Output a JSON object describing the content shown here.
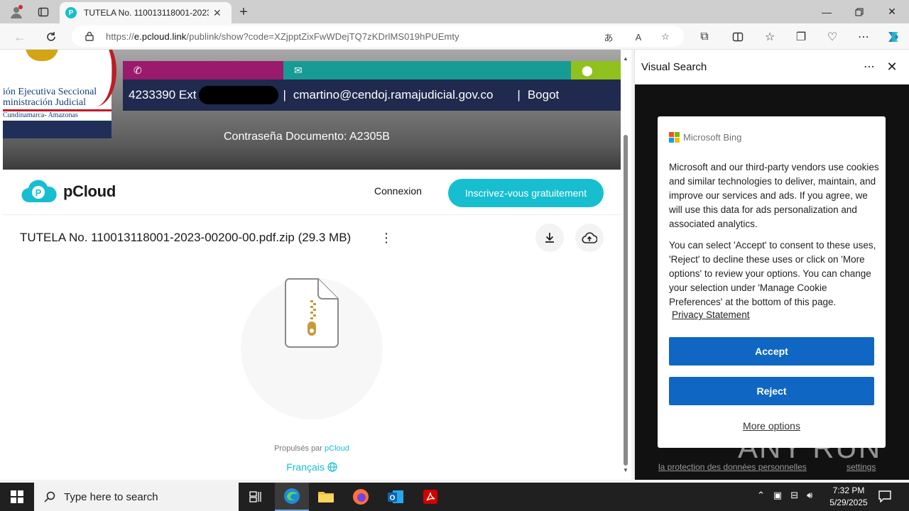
{
  "browser": {
    "tab_title": "TUTELA No. 110013118001-2023-00200-00.pdf.zip",
    "url_prefix": "https://",
    "url_domain": "e.pcloud.link",
    "url_path": "/publink/show?code=XZjpptZixFwWDejTQ7zKDrlMS019hPUEmty",
    "favicon_letter": "P"
  },
  "banner": {
    "logo_line1": "ión Ejecutiva Seccional",
    "logo_line2": "ministración Judicial",
    "logo_line3": "Cundinamarca- Amazonas",
    "phone": "4233390 Ext",
    "email": "cmartino@cendoj.ramajudicial.gov.co",
    "city": "Bogot",
    "password_note": "Contraseña Documento: A2305B"
  },
  "pcloud": {
    "brand": "pCloud",
    "login_label": "Connexion",
    "signup_label": "Inscrivez-vous gratuitement",
    "file_name": "TUTELA No. 110013118001-2023-00200-00.pdf.zip (29.3 MB)",
    "powered_by": "Propulsés par",
    "powered_brand": "pCloud",
    "language": "Français"
  },
  "side_panel": {
    "title": "Visual Search",
    "bing_name": "Microsoft Bing",
    "consent_p1": "Microsoft and our third-party vendors use cookies and similar technologies to deliver, maintain, and improve our services and ads. If you agree, we will use this data for ads personalization and associated analytics.",
    "consent_p2": "You can select 'Accept' to consent to these uses, 'Reject' to decline these uses or click on 'More options' to review your options. You can change your selection under 'Manage Cookie Preferences' at the bottom of this page.",
    "privacy_link": "Privacy Statement",
    "accept_label": "Accept",
    "reject_label": "Reject",
    "more_options_label": "More options",
    "behind_link1": "la protection des données personnelles",
    "behind_link2": "settings",
    "watermark": "ANY RUN"
  },
  "taskbar": {
    "search_placeholder": "Type here to search",
    "time": "7:32 PM",
    "date": "5/29/2025"
  },
  "colors": {
    "accent": "#17bed0",
    "consent_button": "#0f67c3"
  }
}
